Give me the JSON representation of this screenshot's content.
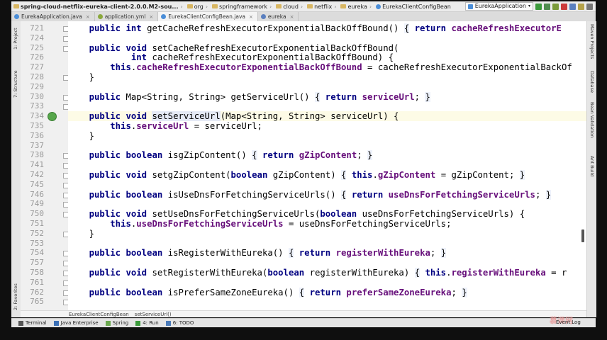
{
  "navbar": {
    "crumbs": [
      {
        "label": "spring-cloud-netflix-eureka-client-2.0.0.M2-sou...",
        "bold": true
      },
      {
        "label": "org"
      },
      {
        "label": "springframework"
      },
      {
        "label": "cloud"
      },
      {
        "label": "netflix"
      },
      {
        "label": "eureka"
      },
      {
        "label": "EurekaClientConfigBean"
      }
    ],
    "run_config": "EurekaApplication"
  },
  "tabs": [
    {
      "label": "EurekaApplication.java",
      "color": "#4b8ed8",
      "active": false
    },
    {
      "label": "application.yml",
      "color": "#8aa83c",
      "active": false
    },
    {
      "label": "EurekaClientConfigBean.java",
      "color": "#4b8ed8",
      "active": true
    },
    {
      "label": "eureka",
      "color": "#5a7fbf",
      "active": false
    }
  ],
  "left_tools": [
    "1: Project",
    "7: Structure",
    "2: Favorites"
  ],
  "right_tools": [
    "Maven Projects",
    "Database",
    "Bean Validation",
    "Ant Build"
  ],
  "lines": [
    {
      "n": "721",
      "html": "    <span class=\"kw\">public int</span> getCacheRefreshExecutorExponentialBackOffBound() <span class=\"hl\">{</span> <span class=\"kw\">return</span> <span class=\"fld\">cacheRefreshExecutorE</span>"
    },
    {
      "n": "724",
      "html": ""
    },
    {
      "n": "725",
      "html": "    <span class=\"kw\">public void</span> setCacheRefreshExecutorExponentialBackOffBound("
    },
    {
      "n": "726",
      "html": "            <span class=\"kw\">int</span> cacheRefreshExecutorExponentialBackOffBound) {"
    },
    {
      "n": "727",
      "html": "        <span class=\"kw\">this</span>.<span class=\"fld\">cacheRefreshExecutorExponentialBackOffBound</span> = cacheRefreshExecutorExponentialBackOf"
    },
    {
      "n": "728",
      "html": "    }"
    },
    {
      "n": "729",
      "html": ""
    },
    {
      "n": "730",
      "html": "    <span class=\"kw\">public</span> Map&lt;String, String&gt; getServiceUrl() <span class=\"hl\">{</span> <span class=\"kw\">return</span> <span class=\"fld\">serviceUrl</span>; <span class=\"hl\">}</span>"
    },
    {
      "n": "733",
      "html": ""
    },
    {
      "n": "734",
      "html": "    <span class=\"kw\">public void</span> <span class=\"meth-hl\">setServiceUrl</span>(Map&lt;String, String&gt; serviceUrl) {",
      "caret": true
    },
    {
      "n": "735",
      "html": "        <span class=\"kw\">this</span>.<span class=\"fld\">serviceUrl</span> = serviceUrl;"
    },
    {
      "n": "736",
      "html": "    }"
    },
    {
      "n": "737",
      "html": ""
    },
    {
      "n": "738",
      "html": "    <span class=\"kw\">public boolean</span> isgZipContent() <span class=\"hl\">{</span> <span class=\"kw\">return</span> <span class=\"fld\">gZipContent</span>; <span class=\"hl\">}</span>"
    },
    {
      "n": "741",
      "html": ""
    },
    {
      "n": "742",
      "html": "    <span class=\"kw\">public void</span> setgZipContent(<span class=\"kw\">boolean</span> gZipContent) <span class=\"hl\">{</span> <span class=\"kw\">this</span>.<span class=\"fld\">gZipContent</span> = gZipContent; <span class=\"hl\">}</span>"
    },
    {
      "n": "745",
      "html": ""
    },
    {
      "n": "746",
      "html": "    <span class=\"kw\">public boolean</span> isUseDnsForFetchingServiceUrls() <span class=\"hl\">{</span> <span class=\"kw\">return</span> <span class=\"fld\">useDnsForFetchingServiceUrls</span>; <span class=\"hl\">}</span>"
    },
    {
      "n": "749",
      "html": ""
    },
    {
      "n": "750",
      "html": "    <span class=\"kw\">public void</span> setUseDnsForFetchingServiceUrls(<span class=\"kw\">boolean</span> useDnsForFetchingServiceUrls) {"
    },
    {
      "n": "751",
      "html": "        <span class=\"kw\">this</span>.<span class=\"fld\">useDnsForFetchingServiceUrls</span> = useDnsForFetchingServiceUrls;"
    },
    {
      "n": "752",
      "html": "    }"
    },
    {
      "n": "753",
      "html": ""
    },
    {
      "n": "754",
      "html": "    <span class=\"kw\">public boolean</span> isRegisterWithEureka() <span class=\"hl\">{</span> <span class=\"kw\">return</span> <span class=\"fld\">registerWithEureka</span>; <span class=\"hl\">}</span>"
    },
    {
      "n": "757",
      "html": ""
    },
    {
      "n": "758",
      "html": "    <span class=\"kw\">public void</span> setRegisterWithEureka(<span class=\"kw\">boolean</span> registerWithEureka) <span class=\"hl\">{</span> <span class=\"kw\">this</span>.<span class=\"fld\">registerWithEureka</span> = r"
    },
    {
      "n": "761",
      "html": ""
    },
    {
      "n": "762",
      "html": "    <span class=\"kw\">public boolean</span> isPreferSameZoneEureka() <span class=\"hl\">{</span> <span class=\"kw\">return</span> <span class=\"fld\">preferSameZoneEureka</span>; <span class=\"hl\">}</span>"
    },
    {
      "n": "765",
      "html": ""
    }
  ],
  "editor_breadcrumbs": [
    "EurekaClientConfigBean",
    "setServiceUrl()"
  ],
  "bottom_tools": [
    {
      "label": "Terminal",
      "color": "#555555"
    },
    {
      "label": "Java Enterprise",
      "color": "#3a6fb5"
    },
    {
      "label": "Spring",
      "color": "#6aa84f"
    },
    {
      "label": "4: Run",
      "color": "#3a9a3a"
    },
    {
      "label": "6: TODO",
      "color": "#4a7ab8"
    }
  ],
  "watermark": "慕课网",
  "event_log": "Event Log"
}
